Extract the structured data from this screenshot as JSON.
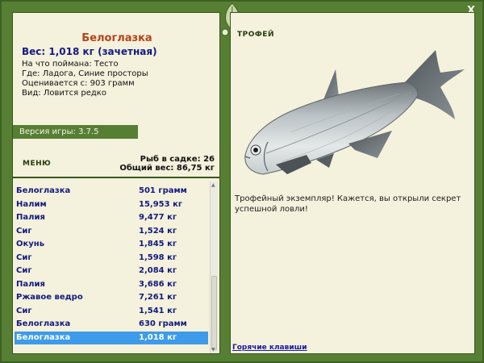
{
  "fish": {
    "title": "Белоглазка",
    "weight_line": "Вес: 1,018 кг (зачетная)",
    "info": [
      "На что поймана: Тесто",
      "Где: Ладога, Синие просторы",
      "Оценивается с: 903 грамм",
      "Вид: Ловится редко"
    ]
  },
  "version": "Версия игры: 3.7.5",
  "menu_label": "МЕНЮ",
  "stats": {
    "sadok": "Рыб в садке: 26",
    "total": "Общий вес: 86,75 кг"
  },
  "catch_list": [
    {
      "name": "Белоглазка",
      "weight": "501 грамм"
    },
    {
      "name": "Налим",
      "weight": "15,953 кг"
    },
    {
      "name": "Палия",
      "weight": "9,477 кг"
    },
    {
      "name": "Сиг",
      "weight": "1,524 кг"
    },
    {
      "name": "Окунь",
      "weight": "1,845 кг"
    },
    {
      "name": "Сиг",
      "weight": "1,598 кг"
    },
    {
      "name": "Сиг",
      "weight": "2,084 кг"
    },
    {
      "name": "Палия",
      "weight": "3,686 кг"
    },
    {
      "name": "Ржавое ведро",
      "weight": "7,261 кг"
    },
    {
      "name": "Сиг",
      "weight": "1,541 кг"
    },
    {
      "name": "Белоглазка",
      "weight": "630 грамм"
    },
    {
      "name": "Белоглазка",
      "weight": "1,018 кг",
      "selected": true
    }
  ],
  "trophy": {
    "label": "ТРОФЕЙ",
    "text": "Трофейный экземпляр! Кажется, вы открыли секрет успешной ловли!"
  },
  "hotkeys": "Горячие клавиши",
  "close_symbol": "X",
  "colors": {
    "frame_green": "#567f34",
    "panel_bg": "#f4f1dc",
    "title_red": "#b5421a",
    "text_blue": "#141a7e",
    "selection_blue": "#3d9be9"
  }
}
